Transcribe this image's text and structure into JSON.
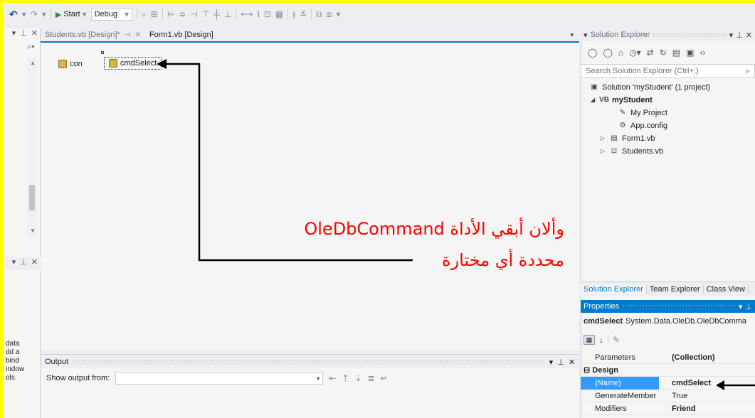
{
  "toolbar": {
    "start_label": "Start",
    "config_value": "Debug"
  },
  "document_tabs": [
    {
      "label": "Students.vb [Design]*"
    },
    {
      "label": "Form1.vb [Design]"
    }
  ],
  "designer": {
    "components": [
      {
        "label": "con"
      },
      {
        "label": "cmdSelect"
      }
    ],
    "annotation_line1": "وألان أبقي الأداة OleDbCommand",
    "annotation_line2": "محددة أي مختارة"
  },
  "left_pane": {
    "text_lines": [
      "data",
      "dd a",
      "bind",
      "indow",
      "ols."
    ]
  },
  "output": {
    "title": "Output",
    "show_from_label": "Show output from:"
  },
  "solution_explorer": {
    "title": "Solution Explorer",
    "search_placeholder": "Search Solution Explorer (Ctrl+;)",
    "tree": [
      {
        "label": "Solution 'myStudent' (1 project)",
        "icon": "solution-icon"
      },
      {
        "label": "myStudent",
        "icon": "vb-project-icon"
      },
      {
        "label": "My Project",
        "icon": "wrench-icon"
      },
      {
        "label": "App.config",
        "icon": "config-icon"
      },
      {
        "label": "Form1.vb",
        "icon": "form-icon"
      },
      {
        "label": "Students.vb",
        "icon": "component-icon"
      }
    ],
    "tabs": [
      {
        "label": "Solution Explorer"
      },
      {
        "label": "Team Explorer"
      },
      {
        "label": "Class View"
      }
    ]
  },
  "properties": {
    "title": "Properties",
    "object_name": "cmdSelect",
    "object_type": "System.Data.OleDb.OleDbComma",
    "rows": [
      {
        "name": "Parameters",
        "value": "(Collection)"
      },
      {
        "name": "Design",
        "value": ""
      },
      {
        "name": "(Name)",
        "value": "cmdSelect"
      },
      {
        "name": "GenerateMember",
        "value": "True"
      },
      {
        "name": "Modifiers",
        "value": "Friend"
      }
    ]
  },
  "colors": {
    "annotation": "#ff0000",
    "accent": "#007acc",
    "highlight": "#ffff00"
  }
}
